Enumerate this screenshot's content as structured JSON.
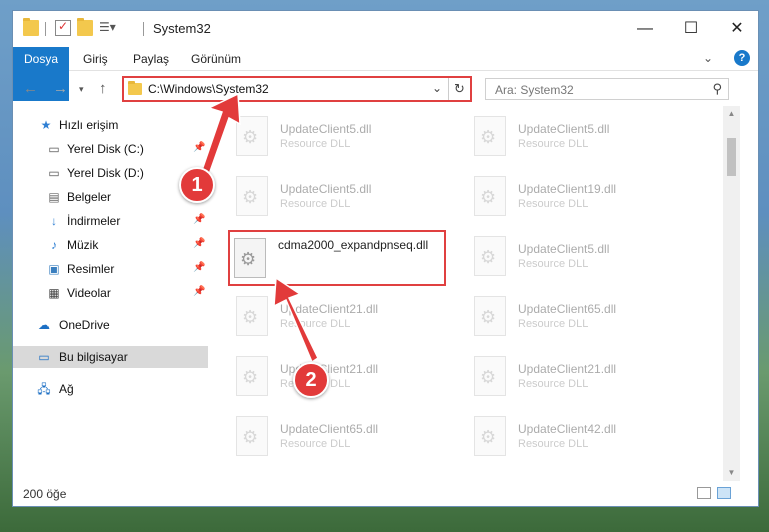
{
  "window": {
    "title": "System32",
    "minimize_glyph": "—",
    "maximize_glyph": "☐",
    "close_glyph": "✕"
  },
  "ribbon": {
    "tabs": [
      {
        "label": "Dosya"
      },
      {
        "label": "Giriş"
      },
      {
        "label": "Paylaş"
      },
      {
        "label": "Görünüm"
      }
    ],
    "help_label": "?"
  },
  "navigation": {
    "address_path": "C:\\Windows\\System32",
    "search_placeholder": "Ara: System32"
  },
  "sidebar": {
    "items": [
      {
        "label": "Hızlı erişim",
        "icon": "star-icon"
      },
      {
        "label": "Yerel Disk (C:)",
        "icon": "drive-icon"
      },
      {
        "label": "Yerel Disk (D:)",
        "icon": "drive-icon"
      },
      {
        "label": "Belgeler",
        "icon": "documents-icon"
      },
      {
        "label": "İndirmeler",
        "icon": "download-icon"
      },
      {
        "label": "Müzik",
        "icon": "music-icon"
      },
      {
        "label": "Resimler",
        "icon": "pictures-icon"
      },
      {
        "label": "Videolar",
        "icon": "video-icon"
      },
      {
        "label": "OneDrive",
        "icon": "cloud-icon"
      },
      {
        "label": "Bu bilgisayar",
        "icon": "computer-icon",
        "selected": true
      },
      {
        "label": "Ağ",
        "icon": "network-icon"
      }
    ]
  },
  "files": {
    "col1": [
      {
        "name": "UpdateClient5.dll",
        "desc": "Resource DLL"
      },
      {
        "name": "UpdateClient5.dll",
        "desc": "Resource DLL"
      },
      {
        "name": "cdma2000_expandpnseq.dll",
        "desc": ""
      },
      {
        "name": "UpdateClient21.dll",
        "desc": "Resource DLL"
      },
      {
        "name": "UpdateClient21.dll",
        "desc": "Resource DLL"
      },
      {
        "name": "UpdateClient65.dll",
        "desc": "Resource DLL"
      }
    ],
    "col2": [
      {
        "name": "UpdateClient5.dll",
        "desc": "Resource DLL"
      },
      {
        "name": "UpdateClient19.dll",
        "desc": "Resource DLL"
      },
      {
        "name": "UpdateClient5.dll",
        "desc": "Resource DLL"
      },
      {
        "name": "UpdateClient65.dll",
        "desc": "Resource DLL"
      },
      {
        "name": "UpdateClient21.dll",
        "desc": "Resource DLL"
      },
      {
        "name": "UpdateClient42.dll",
        "desc": "Resource DLL"
      }
    ]
  },
  "status": {
    "item_count": "200 öğe"
  },
  "annotations": {
    "callout1": "1",
    "callout2": "2",
    "color": "#e23a3a"
  }
}
